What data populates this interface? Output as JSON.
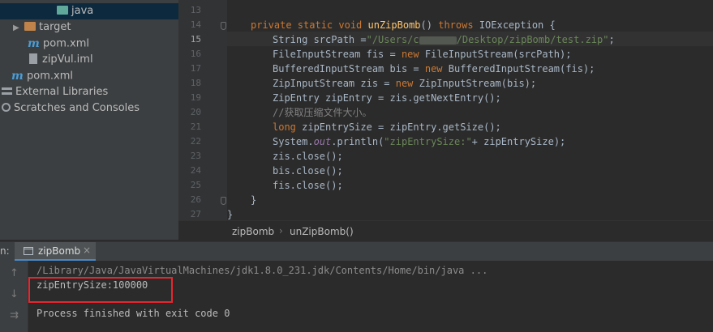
{
  "project_tree": {
    "items": [
      {
        "label": "java",
        "icon": "folder-teal"
      },
      {
        "label": "target",
        "icon": "folder-orange"
      },
      {
        "label": "pom.xml",
        "icon": "maven-icon"
      },
      {
        "label": "zipVul.iml",
        "icon": "module-file-icon"
      },
      {
        "label": "pom.xml",
        "icon": "maven-icon"
      },
      {
        "label": "External Libraries",
        "icon": "libraries-icon"
      },
      {
        "label": "Scratches and Consoles",
        "icon": "scratches-icon"
      }
    ],
    "maven_glyph": "m",
    "expand_arrow": "▶"
  },
  "editor": {
    "line_numbers": [
      "13",
      "14",
      "15",
      "16",
      "17",
      "18",
      "19",
      "20",
      "21",
      "22",
      "23",
      "24",
      "25",
      "26",
      "27"
    ],
    "code": {
      "l14": {
        "kw1": "private static void ",
        "fn": "unZipBomb",
        "mid": "() ",
        "kw2": "throws",
        "rest": " IOException {"
      },
      "l15": {
        "pre": "String srcPath =",
        "str1": "\"/Users/c",
        "str2": "/Desktop/zipBomb/test.zip\"",
        "post": ";"
      },
      "l16": {
        "pre": "FileInputStream fis = ",
        "kw": "new",
        "post": " FileInputStream(srcPath);"
      },
      "l17": {
        "pre": "BufferedInputStream bis = ",
        "kw": "new",
        "post": " BufferedInputStream(fis);"
      },
      "l18": {
        "pre": "ZipInputStream zis = ",
        "kw": "new",
        "post": " ZipInputStream(bis);"
      },
      "l19": "ZipEntry zipEntry = zis.getNextEntry();",
      "l20": "//获取压缩文件大小。",
      "l21": {
        "kw": "long",
        "post": " zipEntrySize = zipEntry.getSize();"
      },
      "l22": {
        "pre": "System.",
        "fld": "out",
        "mid": ".println(",
        "str": "\"zipEntrySize:\"",
        "post": "+ zipEntrySize);"
      },
      "l23": "zis.close();",
      "l24": "bis.close();",
      "l25": "fis.close();",
      "l26": "}",
      "l27": "}"
    }
  },
  "breadcrumb": {
    "items": [
      "zipBomb",
      "unZipBomb()"
    ],
    "separator": "›"
  },
  "run_panel": {
    "label": "n:",
    "tab_label": "zipBomb",
    "tab_close": "×",
    "toolbar_icons": {
      "up": "↑",
      "down": "↓",
      "wrap": "⇉"
    },
    "console": {
      "command": "/Library/Java/JavaVirtualMachines/jdk1.8.0_231.jdk/Contents/Home/bin/java ...",
      "output": "zipEntrySize:100000",
      "exit": "Process finished with exit code 0"
    }
  },
  "colors": {
    "keyword": "#cc7832",
    "function": "#ffc66d",
    "string": "#6a8759",
    "comment": "#808080",
    "highlight_box": "#e8262e"
  }
}
